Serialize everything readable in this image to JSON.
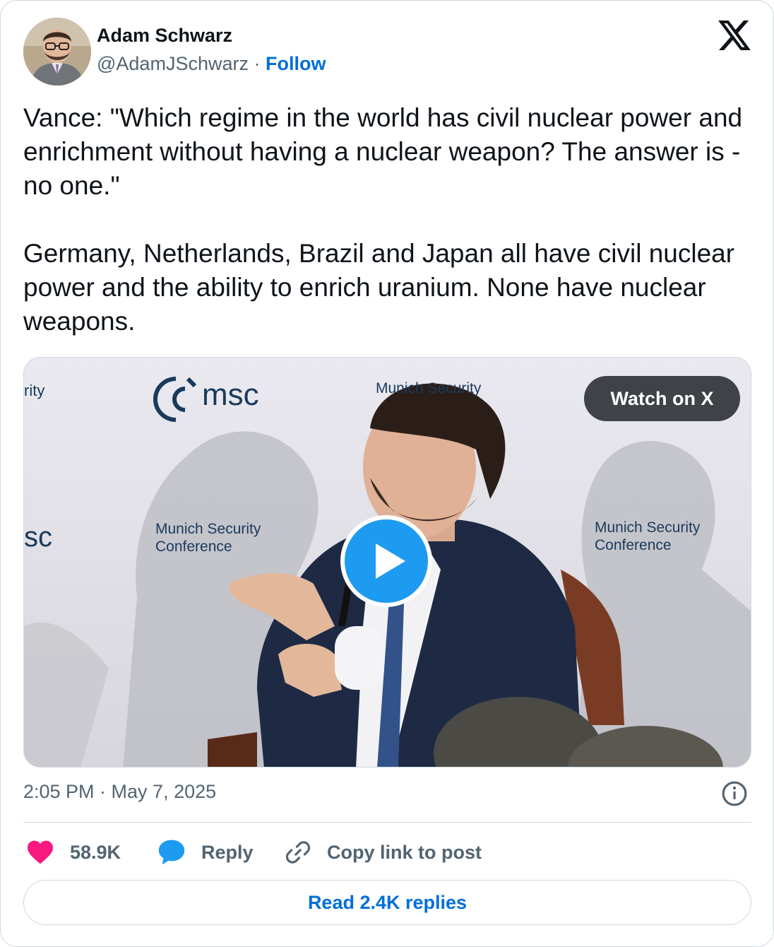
{
  "author": {
    "name": "Adam Schwarz",
    "handle": "@AdamJSchwarz",
    "separator": " · ",
    "follow_label": "Follow"
  },
  "tweet": {
    "text": "Vance: \"Which regime in the world has civil nuclear power and enrichment without having a nuclear weapon? The answer is - no one.\"\n\nGermany, Netherlands, Brazil and Japan all have civil nuclear power and the ability to enrich uranium. None have nuclear weapons."
  },
  "media": {
    "watch_label": "Watch on X",
    "backdrop": {
      "logo_text": "msc",
      "edge_left_top": "rity",
      "edge_left_mid": "sc",
      "conference_line1": "Munich Security",
      "conference_line2": "Conference",
      "banner_partial": "Munich Security"
    }
  },
  "meta": {
    "timestamp": "2:05 PM · May 7, 2025"
  },
  "actions": {
    "likes": "58.9K",
    "reply_label": "Reply",
    "copy_label": "Copy link to post"
  },
  "read_replies_label": "Read 2.4K replies",
  "colors": {
    "link_blue": "#006fd6",
    "like_pink": "#f91880",
    "reply_blue": "#1d9bf0",
    "secondary_text": "#536471",
    "border": "#cfd9de"
  },
  "icons": {
    "brand": "x-logo-icon",
    "like": "heart-icon",
    "reply": "speech-bubble-icon",
    "copy": "link-icon",
    "info": "info-icon",
    "play": "play-icon"
  }
}
